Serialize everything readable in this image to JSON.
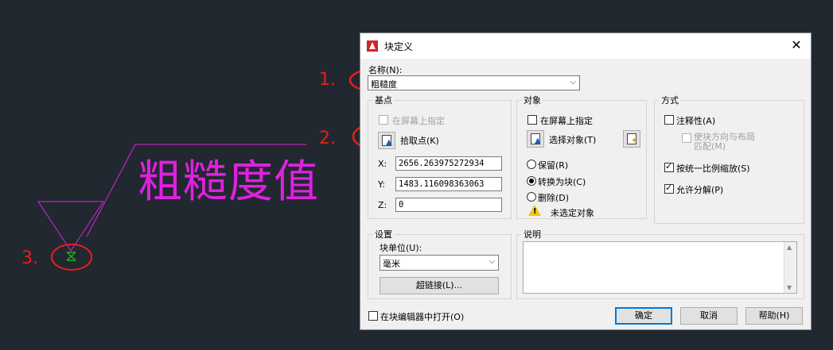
{
  "annotations": [
    "1.",
    "2.",
    "3."
  ],
  "symbol": {
    "text": "粗糙度值",
    "line_color": "#e020e0",
    "marker_color": "#1fae1f"
  },
  "dialog": {
    "title": "块定义",
    "close": "✕",
    "name": {
      "label": "名称(N):",
      "value": "粗糙度"
    },
    "base_point": {
      "title": "基点",
      "specify_on_screen": "在屏幕上指定",
      "pick_point": "拾取点(K)",
      "x_label": "X:",
      "x_value": "2656.263975272934",
      "y_label": "Y:",
      "y_value": "1483.116098363063",
      "z_label": "Z:",
      "z_value": "0"
    },
    "objects": {
      "title": "对象",
      "specify_on_screen": "在屏幕上指定",
      "select_objects": "选择对象(T)",
      "retain": "保留(R)",
      "convert_to_block": "转换为块(C)",
      "delete": "删除(D)",
      "status": "未选定对象"
    },
    "behavior": {
      "title": "方式",
      "annotative": "注释性(A)",
      "match_orientation": "使块方向与布局匹配(M)",
      "scale_uniformly": "按统一比例缩放(S)",
      "allow_exploding": "允许分解(P)"
    },
    "settings": {
      "title": "设置",
      "block_unit_label": "块单位(U):",
      "block_unit_value": "毫米",
      "hyperlink": "超链接(L)..."
    },
    "description": {
      "title": "说明"
    },
    "open_in_editor": "在块编辑器中打开(O)",
    "ok": "确定",
    "cancel": "取消",
    "help": "帮助(H)"
  }
}
